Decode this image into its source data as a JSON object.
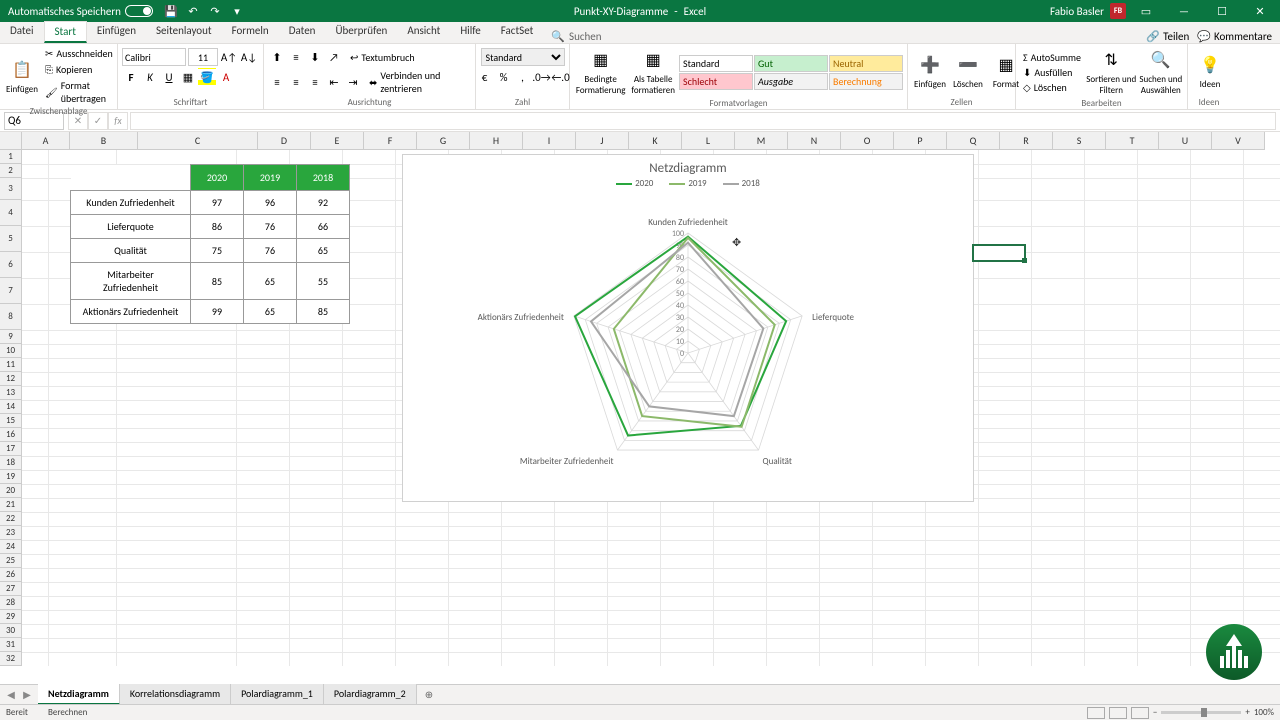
{
  "titlebar": {
    "autosave": "Automatisches Speichern",
    "filename": "Punkt-XY-Diagramme",
    "app": "Excel",
    "username": "Fabio Basler",
    "user_initials": "FB"
  },
  "menu": {
    "tabs": [
      "Datei",
      "Start",
      "Einfügen",
      "Seitenlayout",
      "Formeln",
      "Daten",
      "Überprüfen",
      "Ansicht",
      "Hilfe",
      "FactSet"
    ],
    "active": 1,
    "search": "Suchen",
    "share": "Teilen",
    "comments": "Kommentare"
  },
  "ribbon": {
    "clipboard": {
      "label": "Zwischenablage",
      "paste": "Einfügen",
      "cut": "Ausschneiden",
      "copy": "Kopieren",
      "format": "Format übertragen"
    },
    "font": {
      "label": "Schriftart",
      "name": "Calibri",
      "size": "11"
    },
    "align": {
      "label": "Ausrichtung",
      "wrap": "Textumbruch",
      "merge": "Verbinden und zentrieren"
    },
    "number": {
      "label": "Zahl",
      "format": "Standard"
    },
    "styles": {
      "label": "Formatvorlagen",
      "cond": "Bedingte\nFormatierung",
      "table": "Als Tabelle\nformatieren",
      "s1": "Standard",
      "s2": "Gut",
      "s3": "Neutral",
      "s4": "Schlecht",
      "s5": "Ausgabe",
      "s6": "Berechnung"
    },
    "cells": {
      "label": "Zellen",
      "insert": "Einfügen",
      "delete": "Löschen",
      "format": "Format"
    },
    "editing": {
      "label": "Bearbeiten",
      "sum": "AutoSumme",
      "fill": "Ausfüllen",
      "clear": "Löschen",
      "sort": "Sortieren und\nFiltern",
      "find": "Suchen und\nAuswählen"
    },
    "ideas": {
      "label": "Ideen",
      "btn": "Ideen"
    }
  },
  "namebox": "Q6",
  "cols": [
    "A",
    "B",
    "C",
    "D",
    "E",
    "F",
    "G",
    "H",
    "I",
    "J",
    "K",
    "L",
    "M",
    "N",
    "O",
    "P",
    "Q",
    "R",
    "S",
    "T",
    "U",
    "V"
  ],
  "table": {
    "headers": [
      "2020",
      "2019",
      "2018"
    ],
    "rows": [
      {
        "label": "Kunden Zufriedenheit",
        "v": [
          97,
          96,
          92
        ]
      },
      {
        "label": "Lieferquote",
        "v": [
          86,
          76,
          66
        ]
      },
      {
        "label": "Qualität",
        "v": [
          75,
          76,
          65
        ]
      },
      {
        "label": "Mitarbeiter Zufriedenheit",
        "v": [
          85,
          65,
          55
        ]
      },
      {
        "label": "Aktionärs Zufriedenheit",
        "v": [
          99,
          65,
          85
        ]
      }
    ]
  },
  "chart": {
    "title": "Netzdiagramm",
    "legend": [
      "2020",
      "2019",
      "2018"
    ]
  },
  "chart_data": {
    "type": "radar",
    "title": "Netzdiagramm",
    "categories": [
      "Kunden Zufriedenheit",
      "Lieferquote",
      "Qualität",
      "Mitarbeiter Zufriedenheit",
      "Aktionärs Zufriedenheit"
    ],
    "series": [
      {
        "name": "2020",
        "values": [
          97,
          86,
          75,
          85,
          99
        ],
        "color": "#29a63d"
      },
      {
        "name": "2019",
        "values": [
          96,
          76,
          76,
          65,
          65
        ],
        "color": "#8cb96a"
      },
      {
        "name": "2018",
        "values": [
          92,
          66,
          65,
          55,
          85
        ],
        "color": "#a6a6a6"
      }
    ],
    "ticks": [
      0,
      10,
      20,
      30,
      40,
      50,
      60,
      70,
      80,
      90,
      100
    ],
    "max": 100
  },
  "sheets": {
    "tabs": [
      "Netzdiagramm",
      "Korrelationsdiagramm",
      "Polardiagramm_1",
      "Polardiagramm_2"
    ],
    "active": 0
  },
  "status": {
    "ready": "Bereit",
    "calc": "Berechnen",
    "zoom": "100%"
  }
}
